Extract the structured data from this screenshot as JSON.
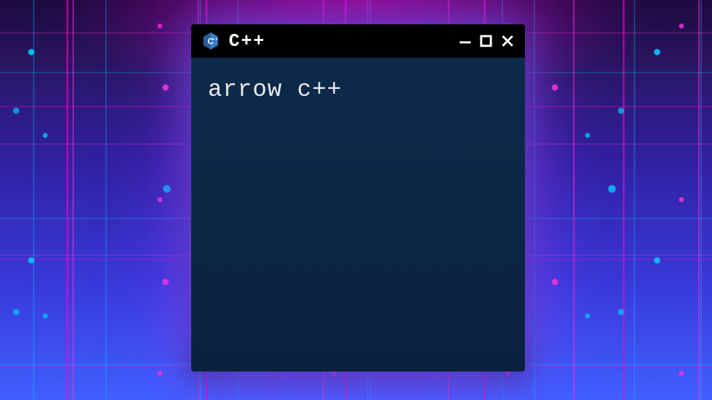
{
  "window": {
    "title": "C++",
    "icon_name": "cpp-logo-icon"
  },
  "terminal": {
    "content": "arrow c++"
  },
  "colors": {
    "titlebar_bg": "#000000",
    "body_bg": "#0d2a4a",
    "text": "#e8e8e8",
    "cpp_logo": "#2a5f9e"
  }
}
